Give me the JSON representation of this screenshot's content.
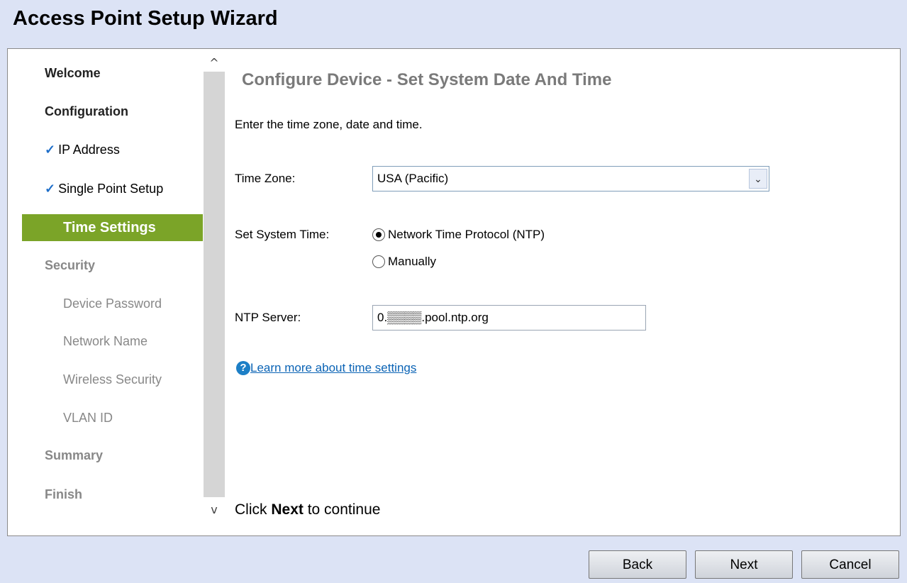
{
  "window": {
    "title": "Access Point Setup Wizard"
  },
  "nav": {
    "welcome": "Welcome",
    "configuration": "Configuration",
    "ip_address": "IP Address",
    "single_point_setup": "Single Point Setup",
    "time_settings": "Time Settings",
    "security": "Security",
    "device_password": "Device Password",
    "network_name": "Network Name",
    "wireless_security": "Wireless Security",
    "vlan_id": "VLAN ID",
    "summary": "Summary",
    "finish": "Finish",
    "check_glyph": "✓"
  },
  "scroll": {
    "up": "^",
    "down": "v"
  },
  "main": {
    "heading": "Configure Device - Set System Date And Time",
    "intro": "Enter the time zone, date and time.",
    "time_zone_label": "Time Zone:",
    "time_zone_value": "USA (Pacific)",
    "set_system_time_label": "Set System Time:",
    "radio_ntp": "Network Time Protocol (NTP)",
    "radio_manual": "Manually",
    "ntp_server_label": "NTP Server:",
    "ntp_server_value": "0.▒▒▒▒.pool.ntp.org",
    "help_icon": "?",
    "help_link": "Learn more about time settings",
    "continue_prefix": "Click ",
    "continue_bold": "Next",
    "continue_suffix": " to continue"
  },
  "footer": {
    "back": "Back",
    "next": "Next",
    "cancel": "Cancel"
  },
  "colors": {
    "active_nav": "#7ba428",
    "background": "#dce3f5",
    "link": "#0a63b5"
  }
}
